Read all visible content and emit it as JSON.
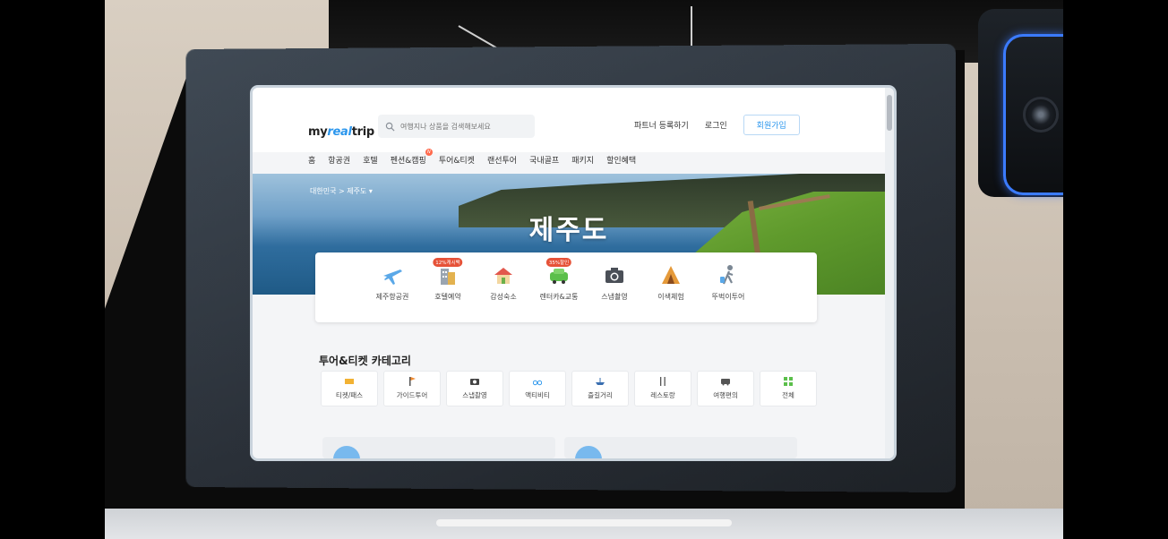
{
  "header": {
    "logo": {
      "my": "my",
      "real": "real",
      "trip": "trip"
    },
    "search_placeholder": "여행지나 상품을 검색해보세요",
    "partner_link": "파트너 등록하기",
    "login_link": "로그인",
    "signup_button": "회원가입"
  },
  "nav": {
    "items": [
      {
        "label": "홈"
      },
      {
        "label": "항공권"
      },
      {
        "label": "호텔"
      },
      {
        "label": "펜션&캠핑",
        "badge": "N"
      },
      {
        "label": "투어&티켓"
      },
      {
        "label": "랜선투어"
      },
      {
        "label": "국내골프"
      },
      {
        "label": "패키지"
      },
      {
        "label": "할인혜택"
      }
    ]
  },
  "hero": {
    "breadcrumb_country": "대한민국",
    "breadcrumb_sep": ">",
    "breadcrumb_region": "제주도",
    "title": "제주도"
  },
  "categories": [
    {
      "label": "제주항공권",
      "icon": "airplane-icon"
    },
    {
      "label": "호텔예약",
      "icon": "hotel-icon",
      "badge": "12%캐시백"
    },
    {
      "label": "감성숙소",
      "icon": "house-icon"
    },
    {
      "label": "렌터카&교통",
      "icon": "car-icon",
      "badge": "35%할인"
    },
    {
      "label": "스냅촬영",
      "icon": "camera-icon"
    },
    {
      "label": "이색체험",
      "icon": "tent-icon"
    },
    {
      "label": "뚜벅이투어",
      "icon": "walker-icon"
    }
  ],
  "tour_section": {
    "title": "투어&티켓 카테고리",
    "items": [
      {
        "label": "티켓/패스",
        "icon": "ticket-icon"
      },
      {
        "label": "가이드투어",
        "icon": "flag-icon"
      },
      {
        "label": "스냅촬영",
        "icon": "camera-icon"
      },
      {
        "label": "액티비티",
        "icon": "bike-icon"
      },
      {
        "label": "즐길거리",
        "icon": "boat-icon"
      },
      {
        "label": "레스토랑",
        "icon": "fork-knife-icon"
      },
      {
        "label": "여행편의",
        "icon": "bus-icon"
      },
      {
        "label": "전체",
        "icon": "grid-icon"
      }
    ]
  },
  "colors": {
    "accent": "#2b96ed",
    "badge": "#e65238"
  }
}
